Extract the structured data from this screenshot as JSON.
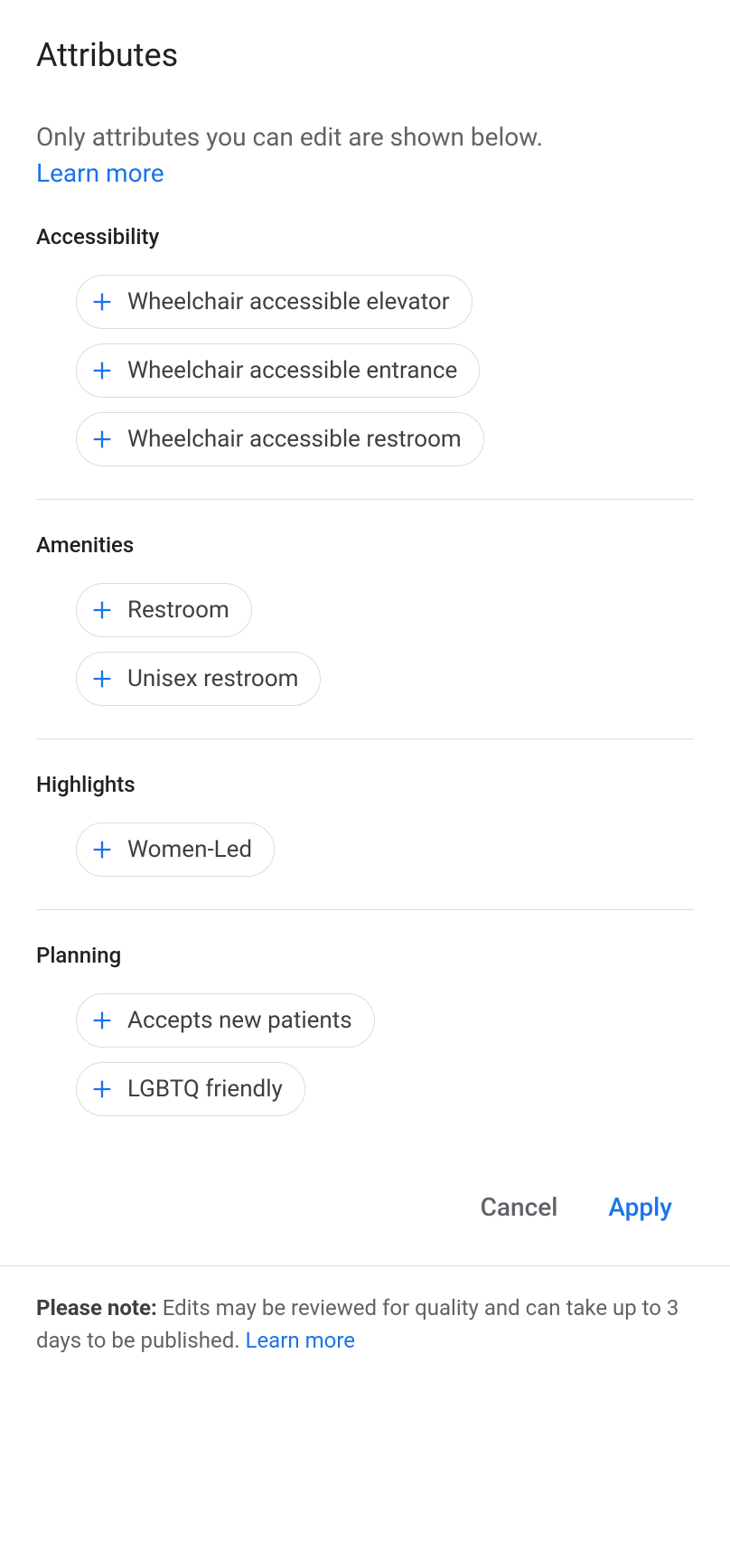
{
  "title": "Attributes",
  "intro": "Only attributes you can edit are shown below.",
  "learn_more": "Learn more",
  "sections": {
    "accessibility": {
      "title": "Accessibility",
      "items": [
        "Wheelchair accessible elevator",
        "Wheelchair accessible entrance",
        "Wheelchair accessible restroom"
      ]
    },
    "amenities": {
      "title": "Amenities",
      "items": [
        "Restroom",
        "Unisex restroom"
      ]
    },
    "highlights": {
      "title": "Highlights",
      "items": [
        "Women-Led"
      ]
    },
    "planning": {
      "title": "Planning",
      "items": [
        "Accepts new patients",
        "LGBTQ friendly"
      ]
    }
  },
  "actions": {
    "cancel": "Cancel",
    "apply": "Apply"
  },
  "footer": {
    "bold": "Please note:",
    "text": " Edits may be reviewed for quality and can take up to 3 days to be published. ",
    "learn_more": "Learn more"
  }
}
